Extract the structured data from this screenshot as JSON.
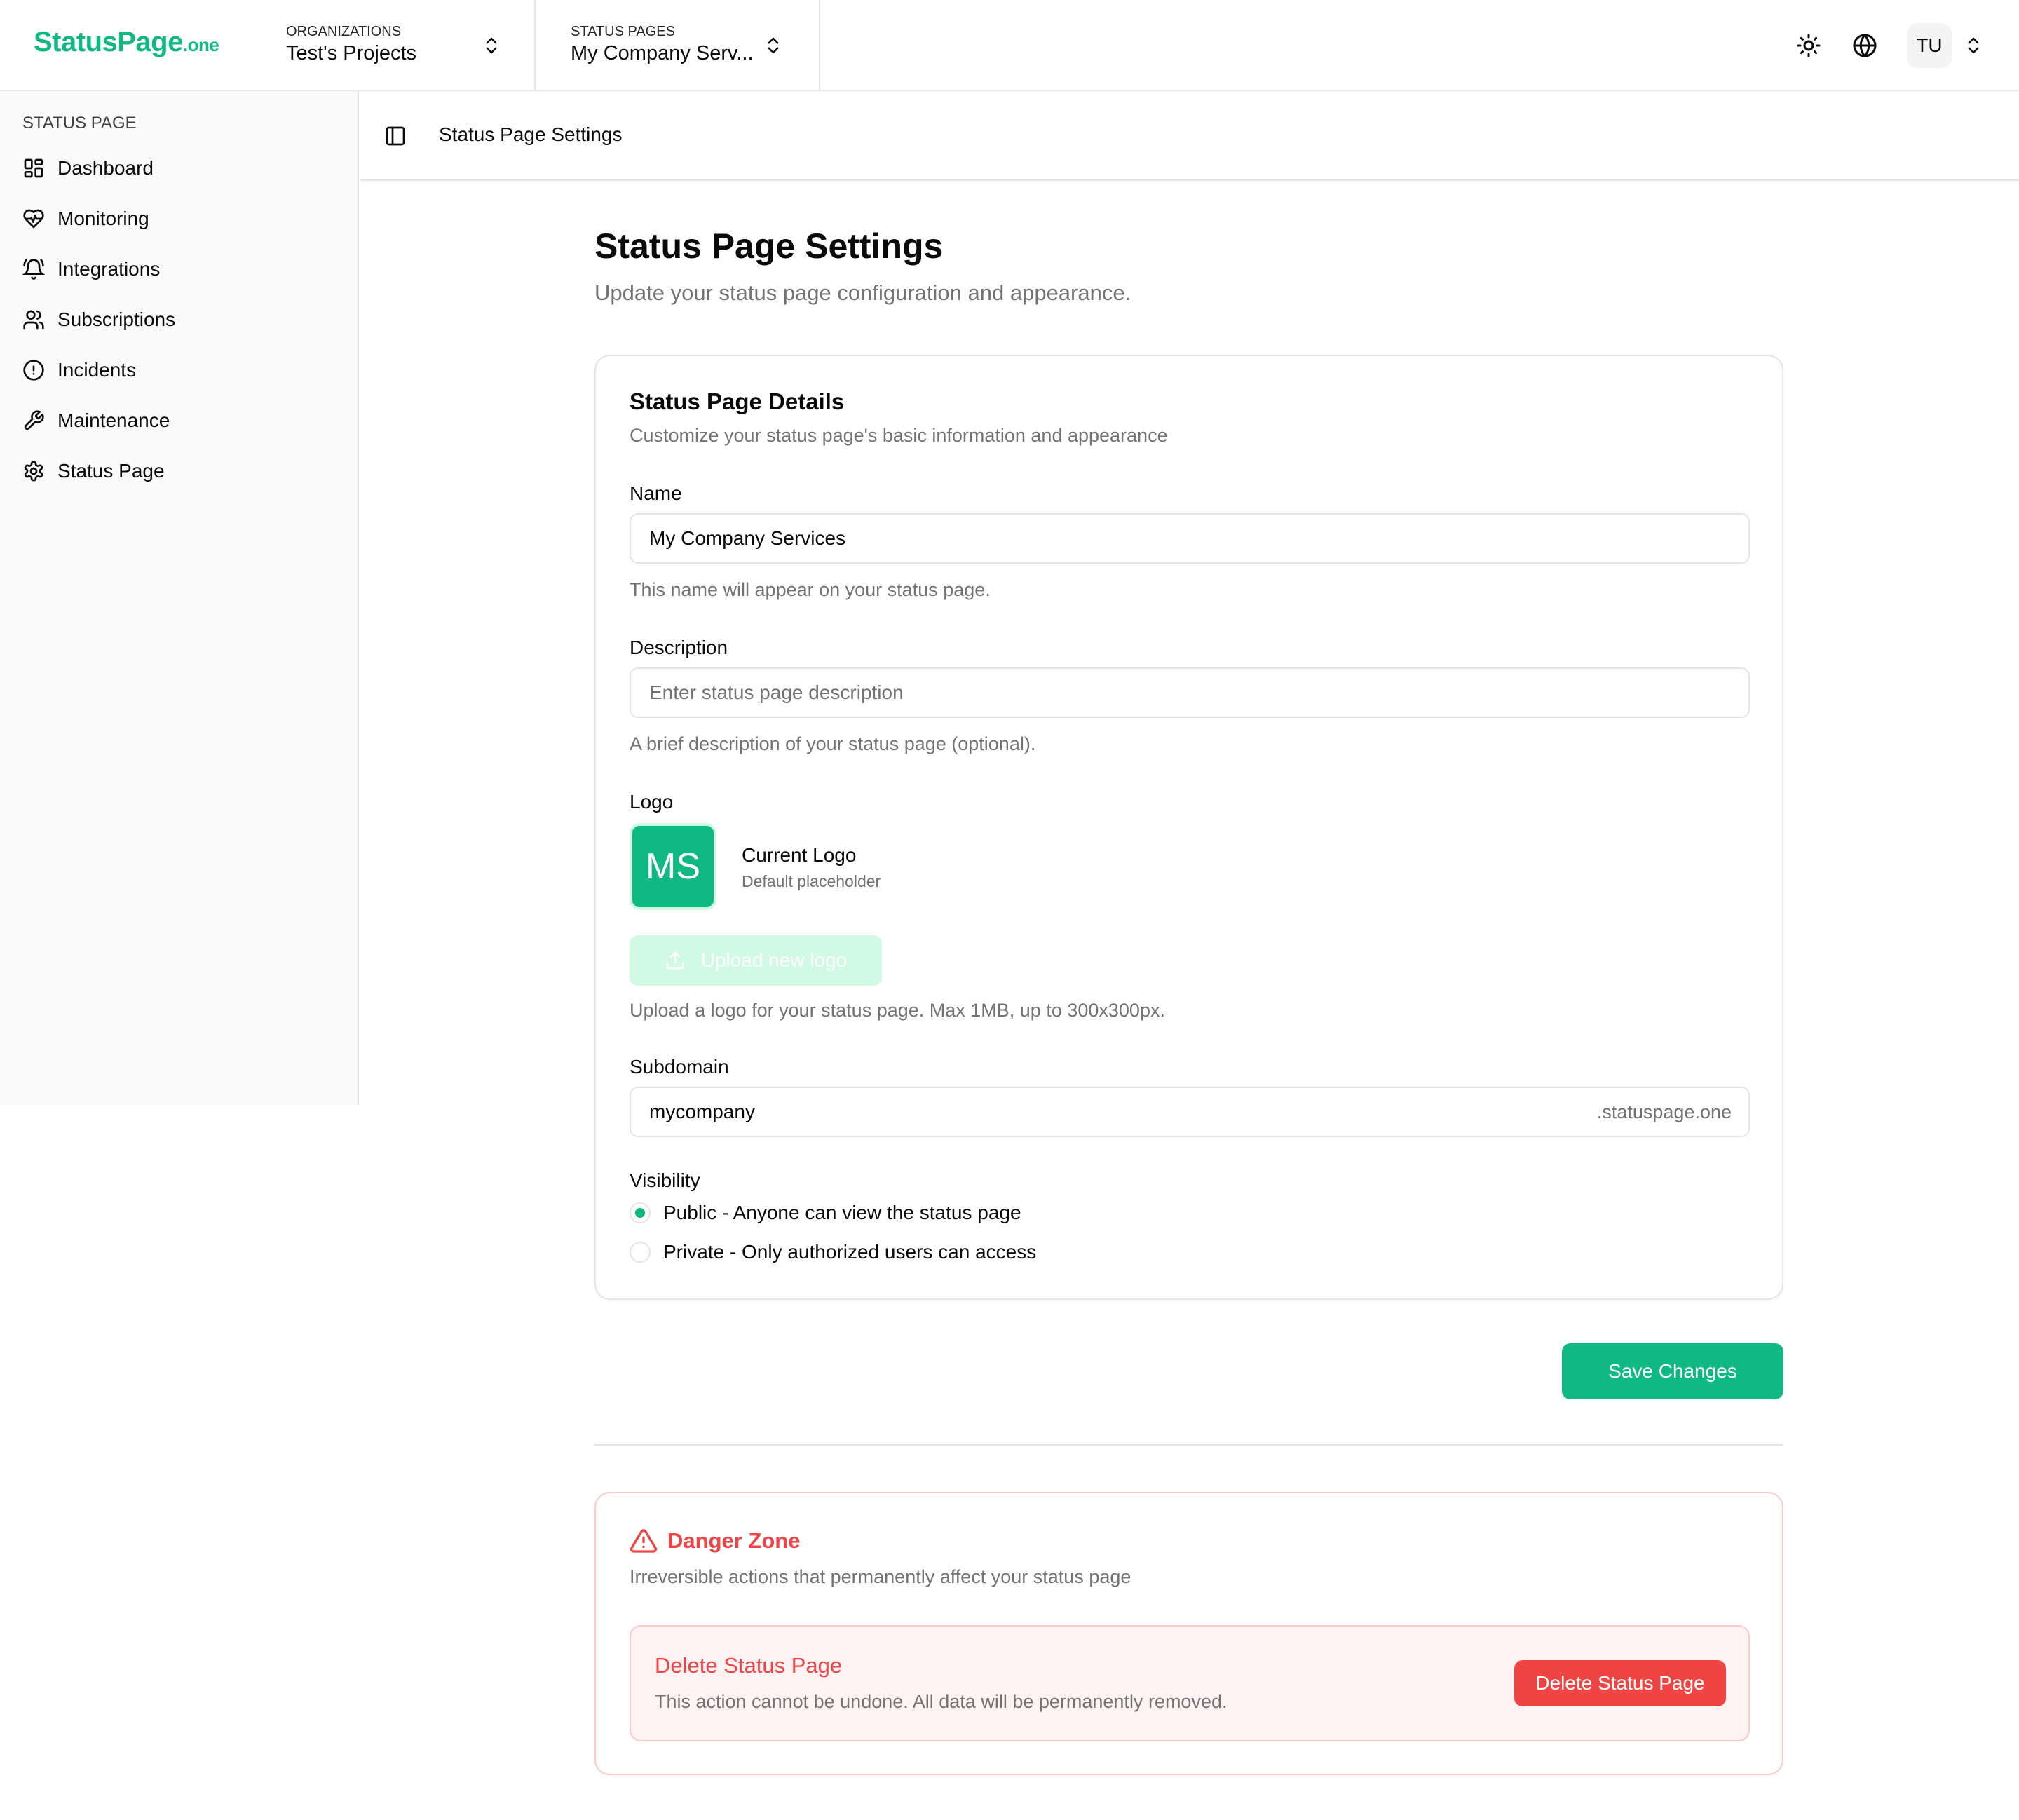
{
  "brand": {
    "name": "StatusPage",
    "suffix": ".one",
    "color": "#10b981"
  },
  "topbar": {
    "organizations": {
      "label": "ORGANIZATIONS",
      "value": "Test's Projects"
    },
    "status_pages": {
      "label": "STATUS PAGES",
      "value": "My Company Serv..."
    },
    "icons": [
      "sun-icon",
      "globe-icon"
    ],
    "user_initials": "TU"
  },
  "sidebar": {
    "section_label": "STATUS PAGE",
    "items": [
      {
        "label": "Dashboard",
        "icon": "dashboard-icon"
      },
      {
        "label": "Monitoring",
        "icon": "heart-pulse-icon"
      },
      {
        "label": "Integrations",
        "icon": "bell-icon"
      },
      {
        "label": "Subscriptions",
        "icon": "users-icon"
      },
      {
        "label": "Incidents",
        "icon": "alert-circle-icon"
      },
      {
        "label": "Maintenance",
        "icon": "wrench-icon"
      },
      {
        "label": "Status Page",
        "icon": "settings-icon"
      }
    ]
  },
  "header": {
    "title": "Status Page Settings"
  },
  "main": {
    "title": "Status Page Settings",
    "subtitle": "Update your status page configuration and appearance."
  },
  "details": {
    "title": "Status Page Details",
    "description": "Customize your status page's basic information and appearance",
    "name": {
      "label": "Name",
      "value": "My Company Services",
      "helper": "This name will appear on your status page."
    },
    "description_field": {
      "label": "Description",
      "placeholder": "Enter status page description",
      "helper": "A brief description of your status page (optional)."
    },
    "logo": {
      "label": "Logo",
      "initials": "MS",
      "current_title": "Current Logo",
      "current_sub": "Default placeholder",
      "upload_label": "Upload new logo",
      "helper": "Upload a logo for your status page. Max 1MB, up to 300x300px."
    },
    "subdomain": {
      "label": "Subdomain",
      "value": "mycompany",
      "suffix": ".statuspage.one"
    },
    "visibility": {
      "label": "Visibility",
      "options": [
        {
          "label": "Public - Anyone can view the status page",
          "selected": true
        },
        {
          "label": "Private - Only authorized users can access",
          "selected": false
        }
      ]
    }
  },
  "actions": {
    "save_label": "Save Changes"
  },
  "danger": {
    "title": "Danger Zone",
    "description": "Irreversible actions that permanently affect your status page",
    "delete_title": "Delete Status Page",
    "delete_desc": "This action cannot be undone. All data will be permanently removed.",
    "delete_button": "Delete Status Page",
    "color": "#ef4444"
  }
}
